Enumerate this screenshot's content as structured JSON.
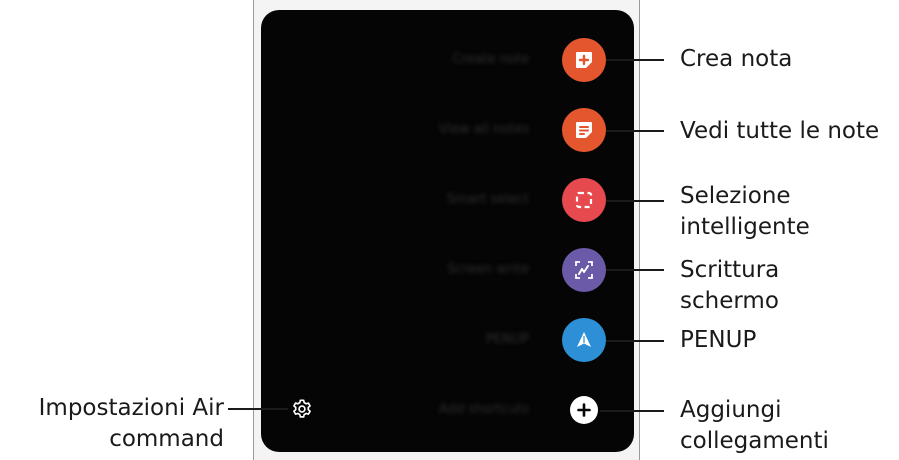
{
  "menu": {
    "items": [
      {
        "ghost": "Create note",
        "label": [
          "Crea nota"
        ],
        "icon": "create-note-icon",
        "color": "#e4572e"
      },
      {
        "ghost": "View all notes",
        "label": [
          "Vedi tutte le note"
        ],
        "icon": "view-notes-icon",
        "color": "#e4572e"
      },
      {
        "ghost": "Smart select",
        "label": [
          "Selezione",
          "intelligente"
        ],
        "icon": "smart-select-icon",
        "color": "#e64a4f"
      },
      {
        "ghost": "Screen write",
        "label": [
          "Scrittura",
          "schermo"
        ],
        "icon": "screen-write-icon",
        "color": "#6a5aa8"
      },
      {
        "ghost": "PENUP",
        "label": [
          "PENUP"
        ],
        "icon": "penup-icon",
        "color": "#2d8fd5"
      },
      {
        "ghost": "Add shortcuts",
        "label": [
          "Aggiungi",
          "collegamenti"
        ],
        "icon": "add-shortcut-icon",
        "color": "#ffffff"
      }
    ]
  },
  "settings": {
    "label": [
      "Impostazioni Air",
      "command"
    ],
    "icon": "gear-icon"
  }
}
